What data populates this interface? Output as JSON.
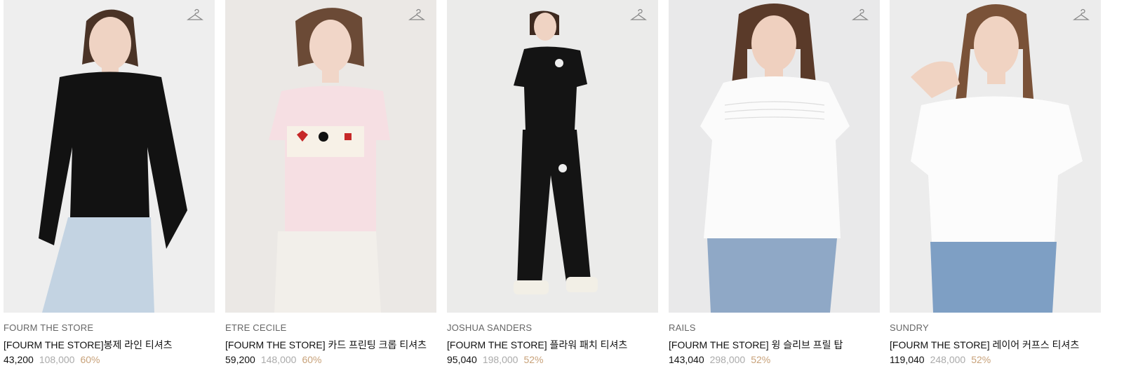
{
  "products": [
    {
      "brand": "FOURM THE STORE",
      "name": "[FOURM THE STORE]봉제 라인 티셔츠",
      "price": "43,200",
      "original_price": "108,000",
      "discount": "60%",
      "colors": {
        "bg": "#eeeeee",
        "top": "#121212",
        "bottom": "#c3d3e2",
        "skin": "#efd3c3",
        "hair": "#4a3326"
      }
    },
    {
      "brand": "ETRE CECILE",
      "name": "[FOURM THE STORE] 카드 프린팅 크롭 티셔츠",
      "price": "59,200",
      "original_price": "148,000",
      "discount": "60%",
      "colors": {
        "bg": "#ebe8e5",
        "top": "#f6dfe3",
        "bottom": "#f2efea",
        "skin": "#f1d6c8",
        "hair": "#6b4a36"
      }
    },
    {
      "brand": "JOSHUA SANDERS",
      "name": "[FOURM THE STORE] 플라워 패치 티셔츠",
      "price": "95,040",
      "original_price": "198,000",
      "discount": "52%",
      "colors": {
        "bg": "#ebebea",
        "top": "#141414",
        "bottom": "#141414",
        "skin": "#efd3c3",
        "hair": "#3e2a20"
      }
    },
    {
      "brand": "RAILS",
      "name": "[FOURM THE STORE] 윙 슬리브 프릴 탑",
      "price": "143,040",
      "original_price": "298,000",
      "discount": "52%",
      "colors": {
        "bg": "#e9e9ea",
        "top": "#fbfbfb",
        "bottom": "#8fa8c6",
        "skin": "#efd0bf",
        "hair": "#5a3a29"
      }
    },
    {
      "brand": "SUNDRY",
      "name": "[FOURM THE STORE] 레이어 커프스 티셔츠",
      "price": "119,040",
      "original_price": "248,000",
      "discount": "52%",
      "colors": {
        "bg": "#ececec",
        "top": "#fcfcfc",
        "bottom": "#7e9fc4",
        "skin": "#f0d3c2",
        "hair": "#7a5238"
      }
    }
  ],
  "icons": {
    "wishlist": "hanger-icon"
  }
}
